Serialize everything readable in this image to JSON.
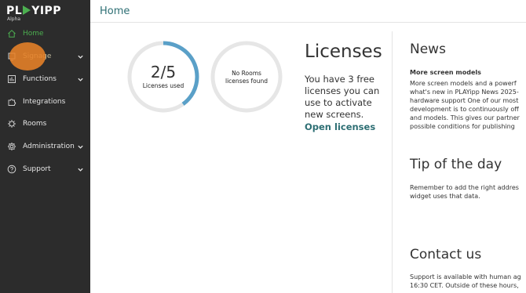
{
  "logo": {
    "text_a": "PL",
    "text_b": "YIPP",
    "subtitle": "Alpha"
  },
  "header": {
    "title": "Home"
  },
  "sidebar": {
    "items": [
      {
        "label": "Home",
        "icon": "home-icon"
      },
      {
        "label": "Signage",
        "icon": "signage-icon"
      },
      {
        "label": "Functions",
        "icon": "functions-icon"
      },
      {
        "label": "Integrations",
        "icon": "puzzle-icon"
      },
      {
        "label": "Rooms",
        "icon": "rooms-icon"
      },
      {
        "label": "Administration",
        "icon": "gear-icon"
      },
      {
        "label": "Support",
        "icon": "help-icon"
      }
    ]
  },
  "license_circle": {
    "value": "2/5",
    "caption": "Licenses used",
    "fraction": 0.4,
    "color": "#5aa0c8"
  },
  "rooms_circle": {
    "line1": "No Rooms",
    "line2": "licenses found"
  },
  "licenses": {
    "title": "Licenses",
    "body": "You have 3 free licenses you can use to activate new screens.",
    "link": "Open licenses"
  },
  "news": {
    "title": "News",
    "headline": "More screen models",
    "lines": [
      "More screen models and a powerf",
      "what's new in PLAYipp News 2025-",
      "hardware support One of our most",
      "development is to continuously off",
      "and models. This gives our partner",
      "possible conditions for publishing"
    ]
  },
  "tip": {
    "title": "Tip of the day",
    "lines": [
      "Remember to add the right addres",
      "widget uses that data."
    ]
  },
  "contact": {
    "title": "Contact us",
    "lines": [
      "Support is available with human ag",
      "16:30 CET. Outside of these hours,"
    ]
  },
  "colors": {
    "accent": "#4caf50",
    "teal": "#2e6f74",
    "sidebar": "#2c2c2c",
    "highlight": "#e88228"
  }
}
